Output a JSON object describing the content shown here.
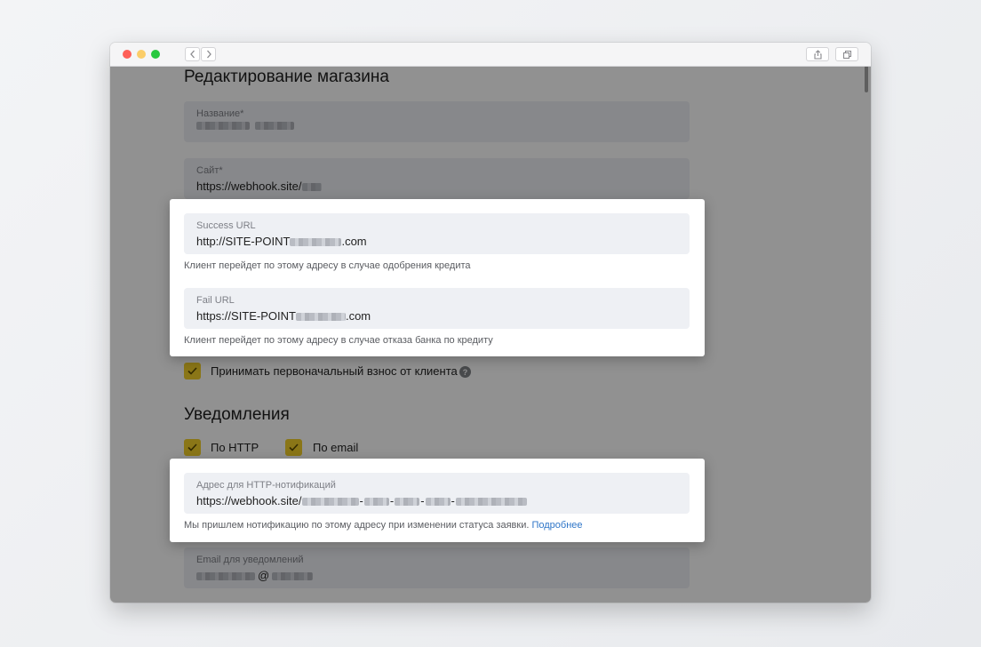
{
  "window": {
    "traffic_lights": [
      "close",
      "minimize",
      "zoom"
    ],
    "toolbar_icons": [
      "chevron-left-icon",
      "chevron-right-icon",
      "share-icon",
      "tabs-icon"
    ]
  },
  "page": {
    "title": "Редактирование магазина",
    "fields": {
      "name": {
        "label": "Название*",
        "value": ""
      },
      "site": {
        "label": "Сайт*",
        "value": "https://webhook.site/"
      },
      "success_url": {
        "label": "Success URL",
        "value_prefix": "http://SITE-POINT",
        "value_suffix": ".com"
      },
      "success_hint": "Клиент перейдет по этому адресу в случае одобрения кредита",
      "fail_url": {
        "label": "Fail URL",
        "value_prefix": "https://SITE-POINT",
        "value_suffix": ".com"
      },
      "fail_hint": "Клиент перейдет по этому адресу в случае отказа банка по кредиту"
    },
    "accept_down_payment": {
      "label": "Принимать первоначальный взнос от клиента",
      "checked": true
    },
    "notifications": {
      "title": "Уведомления",
      "by_http": {
        "label": "По HTTP",
        "checked": true
      },
      "by_email": {
        "label": "По email",
        "checked": true
      },
      "http_address": {
        "label": "Адрес для HTTP-нотификаций",
        "value_prefix": "https://webhook.site/",
        "value_separator": "-"
      },
      "http_hint": "Мы пришлем нотификацию по этому адресу при изменении статуса заявки.",
      "http_hint_link": "Подробнее",
      "email": {
        "label": "Email для уведомлений",
        "value_at": "@"
      }
    }
  },
  "colors": {
    "checkbox": "#f2cf2a",
    "link": "#2f76c8",
    "field_bg": "#eef0f4",
    "overlay": "rgba(0,0,0,0.43)"
  }
}
